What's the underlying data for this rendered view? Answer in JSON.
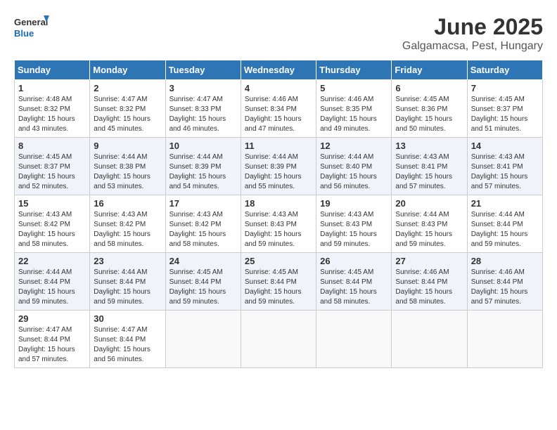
{
  "logo": {
    "line1": "General",
    "line2": "Blue"
  },
  "title": "June 2025",
  "subtitle": "Galgamacsa, Pest, Hungary",
  "headers": [
    "Sunday",
    "Monday",
    "Tuesday",
    "Wednesday",
    "Thursday",
    "Friday",
    "Saturday"
  ],
  "weeks": [
    [
      {
        "day": "1",
        "sunrise": "Sunrise: 4:48 AM",
        "sunset": "Sunset: 8:32 PM",
        "daylight": "Daylight: 15 hours and 43 minutes."
      },
      {
        "day": "2",
        "sunrise": "Sunrise: 4:47 AM",
        "sunset": "Sunset: 8:32 PM",
        "daylight": "Daylight: 15 hours and 45 minutes."
      },
      {
        "day": "3",
        "sunrise": "Sunrise: 4:47 AM",
        "sunset": "Sunset: 8:33 PM",
        "daylight": "Daylight: 15 hours and 46 minutes."
      },
      {
        "day": "4",
        "sunrise": "Sunrise: 4:46 AM",
        "sunset": "Sunset: 8:34 PM",
        "daylight": "Daylight: 15 hours and 47 minutes."
      },
      {
        "day": "5",
        "sunrise": "Sunrise: 4:46 AM",
        "sunset": "Sunset: 8:35 PM",
        "daylight": "Daylight: 15 hours and 49 minutes."
      },
      {
        "day": "6",
        "sunrise": "Sunrise: 4:45 AM",
        "sunset": "Sunset: 8:36 PM",
        "daylight": "Daylight: 15 hours and 50 minutes."
      },
      {
        "day": "7",
        "sunrise": "Sunrise: 4:45 AM",
        "sunset": "Sunset: 8:37 PM",
        "daylight": "Daylight: 15 hours and 51 minutes."
      }
    ],
    [
      {
        "day": "8",
        "sunrise": "Sunrise: 4:45 AM",
        "sunset": "Sunset: 8:37 PM",
        "daylight": "Daylight: 15 hours and 52 minutes."
      },
      {
        "day": "9",
        "sunrise": "Sunrise: 4:44 AM",
        "sunset": "Sunset: 8:38 PM",
        "daylight": "Daylight: 15 hours and 53 minutes."
      },
      {
        "day": "10",
        "sunrise": "Sunrise: 4:44 AM",
        "sunset": "Sunset: 8:39 PM",
        "daylight": "Daylight: 15 hours and 54 minutes."
      },
      {
        "day": "11",
        "sunrise": "Sunrise: 4:44 AM",
        "sunset": "Sunset: 8:39 PM",
        "daylight": "Daylight: 15 hours and 55 minutes."
      },
      {
        "day": "12",
        "sunrise": "Sunrise: 4:44 AM",
        "sunset": "Sunset: 8:40 PM",
        "daylight": "Daylight: 15 hours and 56 minutes."
      },
      {
        "day": "13",
        "sunrise": "Sunrise: 4:43 AM",
        "sunset": "Sunset: 8:41 PM",
        "daylight": "Daylight: 15 hours and 57 minutes."
      },
      {
        "day": "14",
        "sunrise": "Sunrise: 4:43 AM",
        "sunset": "Sunset: 8:41 PM",
        "daylight": "Daylight: 15 hours and 57 minutes."
      }
    ],
    [
      {
        "day": "15",
        "sunrise": "Sunrise: 4:43 AM",
        "sunset": "Sunset: 8:42 PM",
        "daylight": "Daylight: 15 hours and 58 minutes."
      },
      {
        "day": "16",
        "sunrise": "Sunrise: 4:43 AM",
        "sunset": "Sunset: 8:42 PM",
        "daylight": "Daylight: 15 hours and 58 minutes."
      },
      {
        "day": "17",
        "sunrise": "Sunrise: 4:43 AM",
        "sunset": "Sunset: 8:42 PM",
        "daylight": "Daylight: 15 hours and 58 minutes."
      },
      {
        "day": "18",
        "sunrise": "Sunrise: 4:43 AM",
        "sunset": "Sunset: 8:43 PM",
        "daylight": "Daylight: 15 hours and 59 minutes."
      },
      {
        "day": "19",
        "sunrise": "Sunrise: 4:43 AM",
        "sunset": "Sunset: 8:43 PM",
        "daylight": "Daylight: 15 hours and 59 minutes."
      },
      {
        "day": "20",
        "sunrise": "Sunrise: 4:44 AM",
        "sunset": "Sunset: 8:43 PM",
        "daylight": "Daylight: 15 hours and 59 minutes."
      },
      {
        "day": "21",
        "sunrise": "Sunrise: 4:44 AM",
        "sunset": "Sunset: 8:44 PM",
        "daylight": "Daylight: 15 hours and 59 minutes."
      }
    ],
    [
      {
        "day": "22",
        "sunrise": "Sunrise: 4:44 AM",
        "sunset": "Sunset: 8:44 PM",
        "daylight": "Daylight: 15 hours and 59 minutes."
      },
      {
        "day": "23",
        "sunrise": "Sunrise: 4:44 AM",
        "sunset": "Sunset: 8:44 PM",
        "daylight": "Daylight: 15 hours and 59 minutes."
      },
      {
        "day": "24",
        "sunrise": "Sunrise: 4:45 AM",
        "sunset": "Sunset: 8:44 PM",
        "daylight": "Daylight: 15 hours and 59 minutes."
      },
      {
        "day": "25",
        "sunrise": "Sunrise: 4:45 AM",
        "sunset": "Sunset: 8:44 PM",
        "daylight": "Daylight: 15 hours and 59 minutes."
      },
      {
        "day": "26",
        "sunrise": "Sunrise: 4:45 AM",
        "sunset": "Sunset: 8:44 PM",
        "daylight": "Daylight: 15 hours and 58 minutes."
      },
      {
        "day": "27",
        "sunrise": "Sunrise: 4:46 AM",
        "sunset": "Sunset: 8:44 PM",
        "daylight": "Daylight: 15 hours and 58 minutes."
      },
      {
        "day": "28",
        "sunrise": "Sunrise: 4:46 AM",
        "sunset": "Sunset: 8:44 PM",
        "daylight": "Daylight: 15 hours and 57 minutes."
      }
    ],
    [
      {
        "day": "29",
        "sunrise": "Sunrise: 4:47 AM",
        "sunset": "Sunset: 8:44 PM",
        "daylight": "Daylight: 15 hours and 57 minutes."
      },
      {
        "day": "30",
        "sunrise": "Sunrise: 4:47 AM",
        "sunset": "Sunset: 8:44 PM",
        "daylight": "Daylight: 15 hours and 56 minutes."
      },
      null,
      null,
      null,
      null,
      null
    ]
  ]
}
